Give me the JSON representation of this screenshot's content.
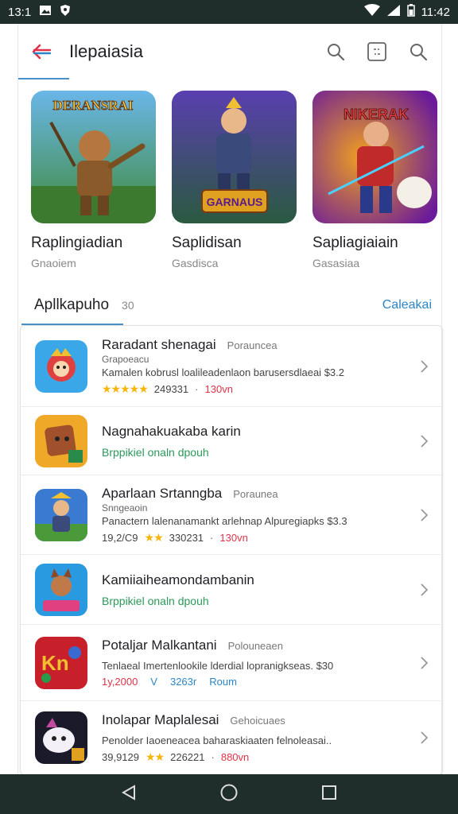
{
  "statusbar": {
    "time_left": "13:1",
    "time_right": "11:42"
  },
  "header": {
    "title": "Ilepaiasia"
  },
  "featured": [
    {
      "name": "Raplingiadian",
      "subtitle": "Gnaoiem",
      "art": "DERANSRAI"
    },
    {
      "name": "Saplidisan",
      "subtitle": "Gasdisca",
      "art": "GARNAUS"
    },
    {
      "name": "Sapliagiaiain",
      "subtitle": "Gasasiaa",
      "art": "NIKERAK"
    }
  ],
  "section": {
    "title": "Apllkapuho",
    "count": "30",
    "link": "Caleakai"
  },
  "apps": [
    {
      "name": "Raradant shenagai",
      "tag": "Porauncea",
      "sub": "Grapoeacu",
      "desc": "Kamalen kobrusl loalileadenlaon barusersdlaeai",
      "desc_tail": "$3.2",
      "stars": "★★★★★",
      "count": "249331",
      "dot": "·",
      "extra": "130vn",
      "extra_color": "red"
    },
    {
      "name": "Nagnahakuakaba karin",
      "green": "Brppikiel onaln dpouh"
    },
    {
      "name": "Aparlaan Srtanngba",
      "tag": "Poraunea",
      "sub": "Snngeaoin",
      "desc": "Panactern lalenanamankt arlehnap Alpuregiapks",
      "desc_tail": "$3.3",
      "prefix": "19,2/C9",
      "stars": "★★",
      "count": "330231",
      "dot": "·",
      "extra": "130vn",
      "extra_color": "red"
    },
    {
      "name": "Kamiiaiheamondambanin",
      "green": "Brppikiel onaln dpouh"
    },
    {
      "name": "Potaljar Malkantani",
      "tag": "Polouneaen",
      "desc": "Tenlaeal Imertenlookile lderdial lopranigkseas.",
      "desc_tail": "$30",
      "prefix": "1y,2000",
      "badge": "V",
      "count": "3263r",
      "extra": "Roum",
      "extra_color": "blue"
    },
    {
      "name": "Inolapar Maplalesai",
      "tag": "Gehoicuaes",
      "desc": "Penolder Iaoeneacea baharaskiaaten felnoleasai..",
      "prefix": "39,9129",
      "stars": "★★",
      "count": "226221",
      "dot": "·",
      "extra": "880vn",
      "extra_color": "red"
    }
  ],
  "colors": {
    "accent": "#2b86c5",
    "statusbar": "#1f2d2b",
    "star": "#f5b50a",
    "price_red": "#e0334a"
  }
}
